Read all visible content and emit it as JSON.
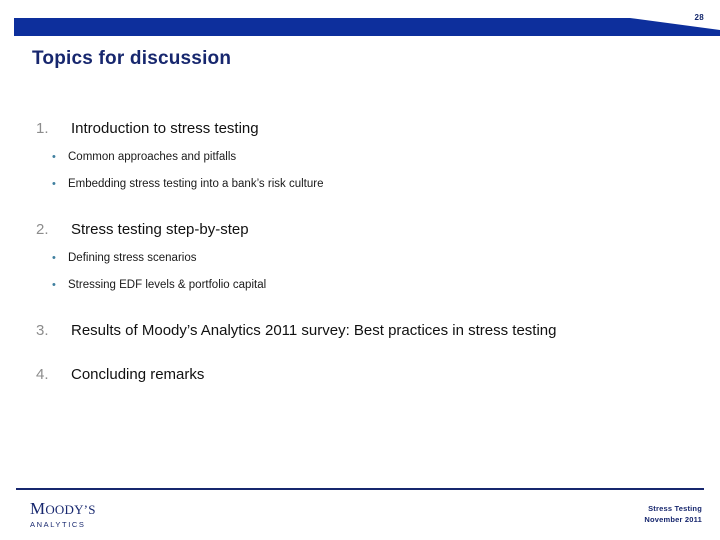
{
  "slide": {
    "page_number": "28",
    "title": "Topics for discussion",
    "banner_color": "#0d2f9c",
    "title_color": "#17276e",
    "number_color": "#8c8c8c",
    "bullet_color": "#3f7f9f"
  },
  "topics": [
    {
      "number": "1.",
      "text": "Introduction to stress testing",
      "subs": [
        {
          "bullet": "•",
          "text": "Common approaches and pitfalls"
        },
        {
          "bullet": "•",
          "text": "Embedding stress testing into a bank’s risk culture"
        }
      ]
    },
    {
      "number": "2.",
      "text": "Stress testing step-by-step",
      "subs": [
        {
          "bullet": "•",
          "text": "Defining stress scenarios"
        },
        {
          "bullet": "•",
          "text": "Stressing EDF levels & portfolio capital"
        }
      ]
    },
    {
      "number": "3.",
      "text": "Results of Moody’s Analytics 2011 survey: Best practices in stress testing",
      "subs": []
    },
    {
      "number": "4.",
      "text": "Concluding remarks",
      "subs": []
    }
  ],
  "footer": {
    "logo_main_prefix": "M",
    "logo_main_rest": "OODY’S",
    "logo_sub": "ANALYTICS",
    "line1": "Stress Testing",
    "line2": "November 2011"
  }
}
